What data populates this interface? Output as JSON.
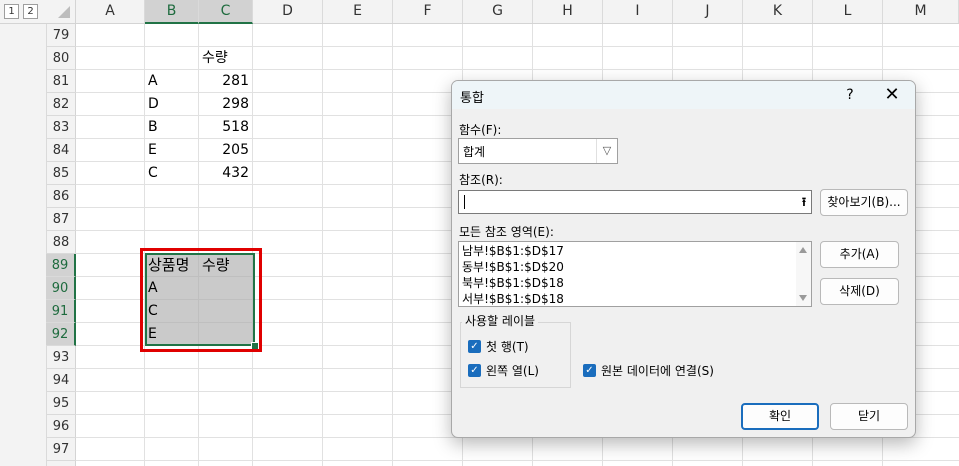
{
  "outline_levels": [
    "1",
    "2"
  ],
  "columns": [
    "A",
    "B",
    "C",
    "D",
    "E",
    "F",
    "G",
    "H",
    "I",
    "J",
    "K",
    "L",
    "M"
  ],
  "rows": [
    "79",
    "80",
    "81",
    "82",
    "83",
    "84",
    "85",
    "86",
    "87",
    "88",
    "89",
    "90",
    "91",
    "92",
    "93",
    "94",
    "95",
    "96",
    "97"
  ],
  "cells": {
    "c80": "수량",
    "data_rows": [
      {
        "b": "A",
        "c": "281"
      },
      {
        "b": "D",
        "c": "298"
      },
      {
        "b": "B",
        "c": "518"
      },
      {
        "b": "E",
        "c": "205"
      },
      {
        "b": "C",
        "c": "432"
      }
    ],
    "b89": "상품명",
    "c89": "수량",
    "b90": "A",
    "b91": "C",
    "b92": "E"
  },
  "dialog": {
    "title": "통합",
    "help_label": "?",
    "close_label": "✕",
    "function_label": "함수(F):",
    "function_value": "합계",
    "reference_label": "참조(R):",
    "reference_value": "",
    "browse_label": "찾아보기(B)...",
    "all_references_label": "모든 참조 영역(E):",
    "references": [
      "남부!$B$1:$D$17",
      "동부!$B$1:$D$20",
      "북부!$B$1:$D$18",
      "서부!$B$1:$D$18"
    ],
    "add_label": "추가(A)",
    "delete_label": "삭제(D)",
    "use_labels_group": "사용할 레이블",
    "top_row_label": "첫 행(T)",
    "top_row_checked": true,
    "left_column_label": "왼쪽 열(L)",
    "left_column_checked": true,
    "link_label": "원본 데이터에 연결(S)",
    "link_checked": true,
    "ok_label": "확인",
    "cancel_label": "닫기"
  },
  "colors": {
    "excel_green": "#217346",
    "highlight_red": "#e00000",
    "checkbox_blue": "#1a6dbd"
  }
}
